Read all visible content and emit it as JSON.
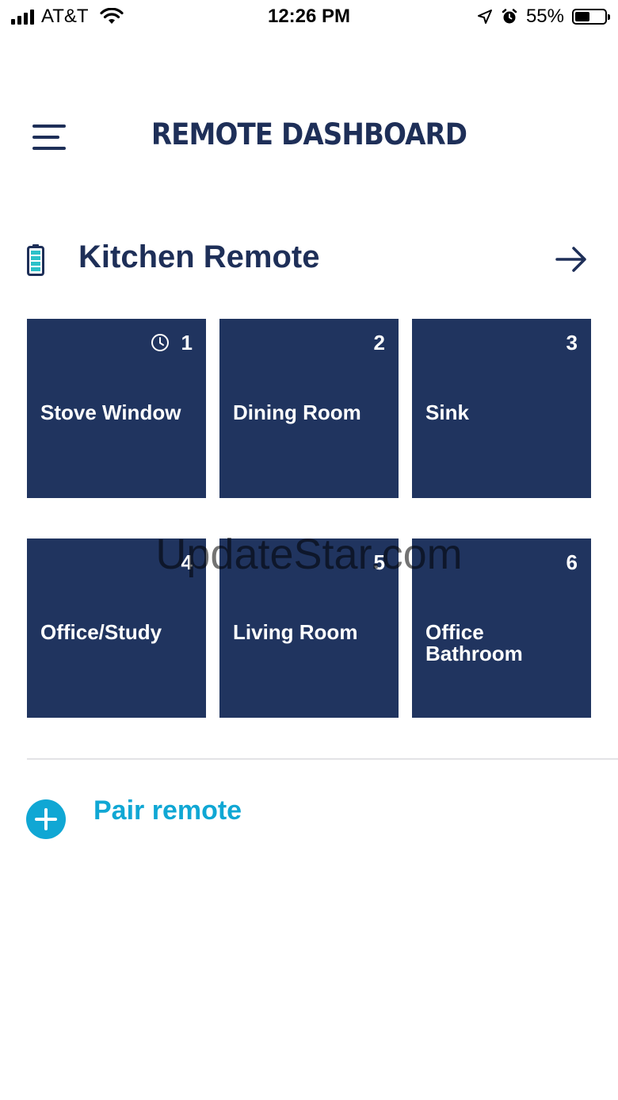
{
  "status_bar": {
    "carrier": "AT&T",
    "time": "12:26 PM",
    "battery_percent": "55%",
    "battery_level": 0.55,
    "icons": [
      "signal-icon",
      "wifi-icon",
      "location-icon",
      "alarm-icon",
      "battery-icon"
    ]
  },
  "header": {
    "menu_icon": "menu-icon",
    "title": "REMOTE DASHBOARD"
  },
  "remote": {
    "name": "Kitchen Remote",
    "battery_icon": "battery-full-icon",
    "arrow_icon": "arrow-right-icon",
    "tiles": [
      {
        "number": "1",
        "label": "Stove Window",
        "has_schedule": true
      },
      {
        "number": "2",
        "label": "Dining Room",
        "has_schedule": false
      },
      {
        "number": "3",
        "label": "Sink",
        "has_schedule": false
      },
      {
        "number": "4",
        "label": "Office/Study",
        "has_schedule": false
      },
      {
        "number": "5",
        "label": "Living Room",
        "has_schedule": false
      },
      {
        "number": "6",
        "label": "Office Bathroom",
        "has_schedule": false
      }
    ]
  },
  "pair": {
    "label": "Pair remote",
    "icon": "plus-circle-icon"
  },
  "watermark": "UpdateStar.com",
  "colors": {
    "navy": "#20345f",
    "title_navy": "#1e2f58",
    "accent_blue": "#10a7d4",
    "battery_green": "#2cc1c9"
  }
}
